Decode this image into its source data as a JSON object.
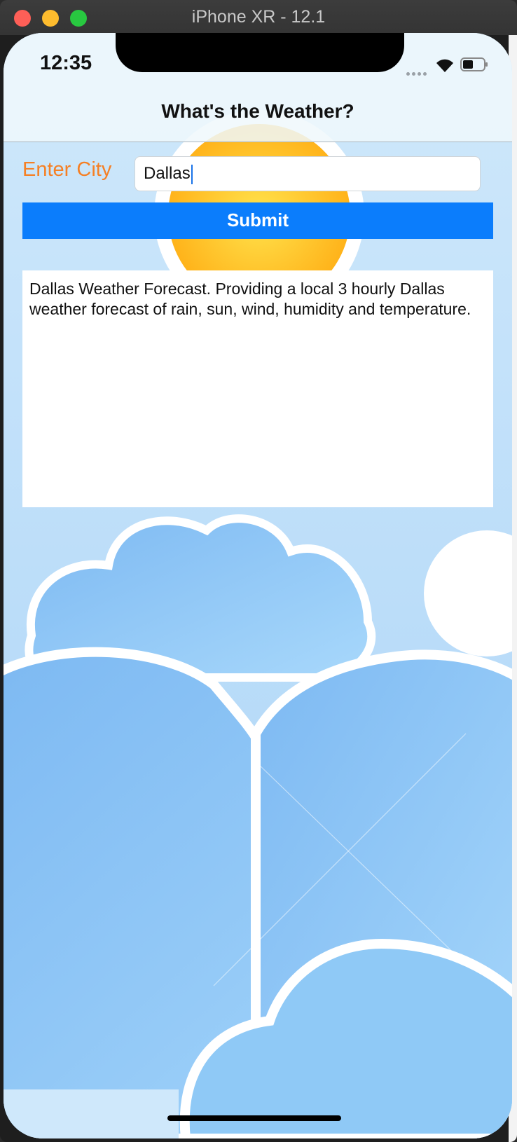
{
  "window": {
    "title": "iPhone XR - 12.1"
  },
  "status_bar": {
    "time": "12:35",
    "icons": [
      "cellular-signal-icon",
      "wifi-icon",
      "battery-icon"
    ]
  },
  "navbar": {
    "title": "What's the Weather?"
  },
  "form": {
    "city_label": "Enter City",
    "city_value": "Dallas",
    "submit_label": "Submit"
  },
  "result": {
    "text": "Dallas Weather Forecast. Providing a local 3 hourly Dallas weather forecast of rain, sun, wind, humidity and temperature."
  },
  "colors": {
    "label_orange": "#f58025",
    "button_blue": "#0b7dfc",
    "sky_blue": "#8ec8f6"
  }
}
